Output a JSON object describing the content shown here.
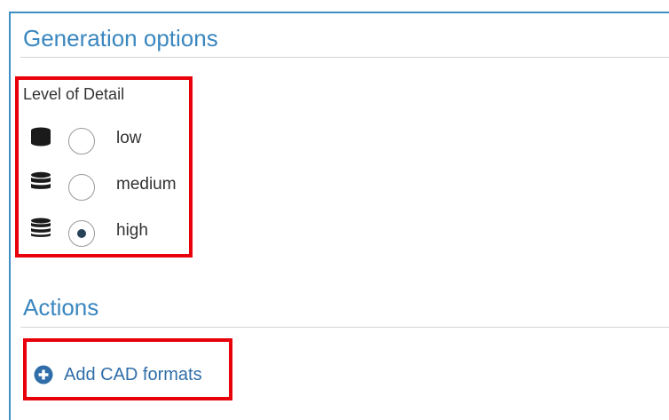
{
  "sections": {
    "generation_title": "Generation options",
    "actions_title": "Actions"
  },
  "level_of_detail": {
    "label": "Level of Detail",
    "options": [
      {
        "label": "low",
        "icon": "database-low-icon",
        "selected": false
      },
      {
        "label": "medium",
        "icon": "database-medium-icon",
        "selected": false
      },
      {
        "label": "high",
        "icon": "database-high-icon",
        "selected": true
      }
    ]
  },
  "actions": {
    "add_cad_label": "Add CAD formats",
    "add_icon": "plus-circle-icon"
  },
  "colors": {
    "accent": "#3a87c0",
    "highlight": "#e8000b",
    "radio_checked": "#27435a"
  }
}
